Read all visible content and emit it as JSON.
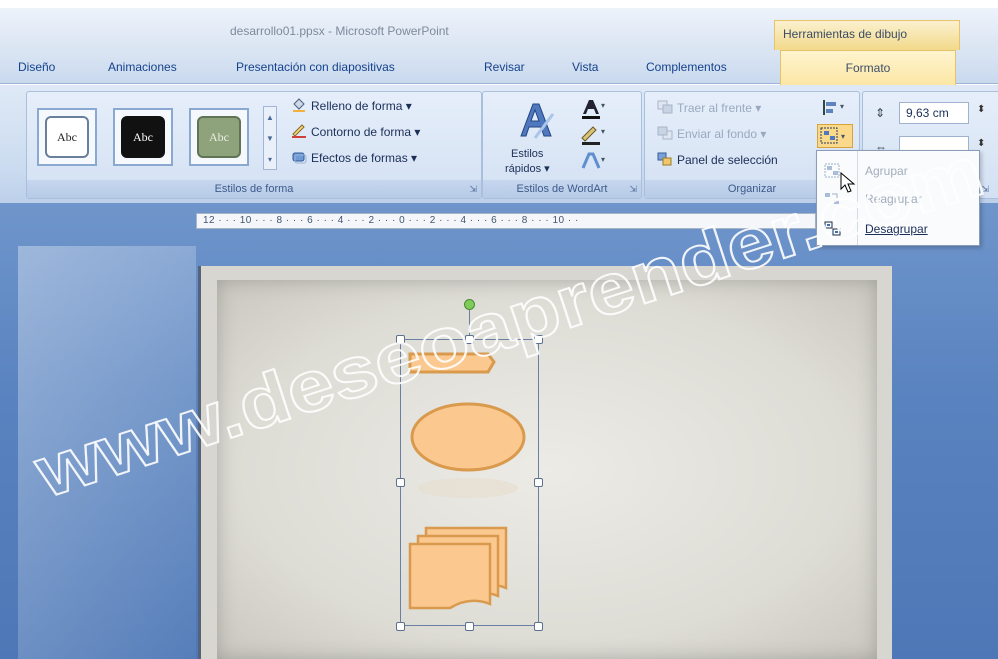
{
  "window": {
    "title": "desarrollo01.ppsx - Microsoft PowerPoint",
    "context_tab_header": "Herramientas de dibujo"
  },
  "tabs": [
    {
      "label": "Diseño"
    },
    {
      "label": "Animaciones"
    },
    {
      "label": "Presentación con diapositivas"
    },
    {
      "label": "Revisar"
    },
    {
      "label": "Vista"
    },
    {
      "label": "Complementos"
    },
    {
      "label": "Formato",
      "active": true
    }
  ],
  "ribbon": {
    "estilos_forma": {
      "label": "Estilos de forma",
      "previews": [
        {
          "text": "Abc",
          "style": "outline"
        },
        {
          "text": "Abc",
          "style": "dark"
        },
        {
          "text": "Abc",
          "style": "green"
        }
      ],
      "relleno": "Relleno de forma",
      "contorno": "Contorno de forma",
      "efectos": "Efectos de formas"
    },
    "wordart": {
      "label": "Estilos de WordArt",
      "estilos_rapidos_line1": "Estilos",
      "estilos_rapidos_line2": "rápidos"
    },
    "organizar": {
      "label": "Organizar",
      "traer_al_frente": "Traer al frente",
      "enviar_al_fondo": "Enviar al fondo",
      "panel_seleccion": "Panel de selección"
    },
    "tamano": {
      "height_value": "9,63 cm"
    }
  },
  "ruler": {
    "text": "12 · · · 10 · · · 8 · · · 6 · · · 4 · · · 2 · · · 0 · · · 2 · · · 4 · · · 6 · · · 8 · · · 10 · ·"
  },
  "dropdown": {
    "items": [
      {
        "label": "Agrupar",
        "enabled": false
      },
      {
        "label": "Reagrupar",
        "enabled": false
      },
      {
        "label": "Desagrupar",
        "enabled": true
      }
    ]
  },
  "watermark": {
    "text": "www.deseoaprender.com"
  },
  "colors": {
    "shape_fill": "#fbc98f",
    "shape_stroke": "#d99a4e",
    "accent_formato": "#fbe6a3",
    "workspace": "#5a84c0"
  }
}
